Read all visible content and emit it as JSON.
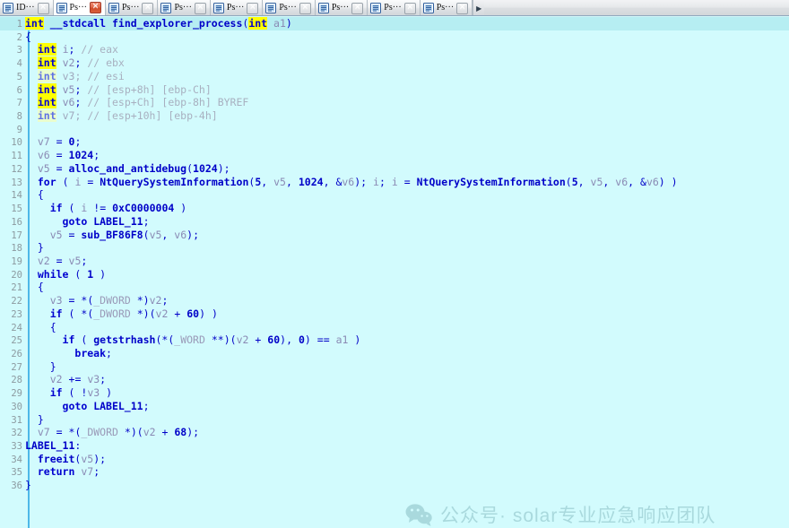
{
  "window": {
    "app": "IDA Pro Hex-Rays Pseudocode View",
    "accent_color": "#0000c8",
    "background_color": "#d2fbfd",
    "current_line_color": "#b6eef2",
    "highlight_color": "#ffff00",
    "gutter_rule_color": "#4db8e8"
  },
  "tabbar": {
    "scroll_right_glyph": "▶",
    "tabs": [
      {
        "label": "ID···",
        "icon": "document-icon",
        "active": false,
        "close_label": "✕",
        "close_style": "grey"
      },
      {
        "label": "Ps···",
        "icon": "document-icon",
        "active": true,
        "close_label": "✕",
        "close_style": "red"
      },
      {
        "label": "Ps···",
        "icon": "document-icon",
        "active": false,
        "close_label": "✕",
        "close_style": "grey"
      },
      {
        "label": "Ps···",
        "icon": "document-icon",
        "active": false,
        "close_label": "✕",
        "close_style": "grey"
      },
      {
        "label": "Ps···",
        "icon": "document-icon",
        "active": false,
        "close_label": "✕",
        "close_style": "grey"
      },
      {
        "label": "Ps···",
        "icon": "document-icon",
        "active": false,
        "close_label": "✕",
        "close_style": "grey"
      },
      {
        "label": "Ps···",
        "icon": "document-icon",
        "active": false,
        "close_label": "✕",
        "close_style": "grey"
      },
      {
        "label": "Ps···",
        "icon": "document-icon",
        "active": false,
        "close_label": "✕",
        "close_style": "grey"
      },
      {
        "label": "Ps···",
        "icon": "document-icon",
        "active": false,
        "close_label": "✕",
        "close_style": "grey"
      }
    ]
  },
  "code": {
    "function_name": "find_explorer_process",
    "lines": [
      {
        "n": "1",
        "current": true,
        "text": "int __stdcall find_explorer_process(int a1)"
      },
      {
        "n": "2",
        "current": false,
        "text": "{"
      },
      {
        "n": "3",
        "current": false,
        "text": "  int i; // eax"
      },
      {
        "n": "4",
        "current": false,
        "text": "  int v2; // ebx"
      },
      {
        "n": "5",
        "current": false,
        "text": "  int v3; // esi"
      },
      {
        "n": "6",
        "current": false,
        "text": "  int v5; // [esp+8h] [ebp-Ch]"
      },
      {
        "n": "7",
        "current": false,
        "text": "  int v6; // [esp+Ch] [ebp-8h] BYREF"
      },
      {
        "n": "8",
        "current": false,
        "text": "  int v7; // [esp+10h] [ebp-4h]"
      },
      {
        "n": "9",
        "current": false,
        "text": ""
      },
      {
        "n": "10",
        "current": false,
        "text": "  v7 = 0;"
      },
      {
        "n": "11",
        "current": false,
        "text": "  v6 = 1024;"
      },
      {
        "n": "12",
        "current": false,
        "text": "  v5 = alloc_and_antidebug(1024);"
      },
      {
        "n": "13",
        "current": false,
        "text": "  for ( i = NtQuerySystemInformation(5, v5, 1024, &v6); i; i = NtQuerySystemInformation(5, v5, v6, &v6) )"
      },
      {
        "n": "14",
        "current": false,
        "text": "  {"
      },
      {
        "n": "15",
        "current": false,
        "text": "    if ( i != 0xC0000004 )"
      },
      {
        "n": "16",
        "current": false,
        "text": "      goto LABEL_11;"
      },
      {
        "n": "17",
        "current": false,
        "text": "    v5 = sub_BF86F8(v5, v6);"
      },
      {
        "n": "18",
        "current": false,
        "text": "  }"
      },
      {
        "n": "19",
        "current": false,
        "text": "  v2 = v5;"
      },
      {
        "n": "20",
        "current": false,
        "text": "  while ( 1 )"
      },
      {
        "n": "21",
        "current": false,
        "text": "  {"
      },
      {
        "n": "22",
        "current": false,
        "text": "    v3 = *(_DWORD *)v2;"
      },
      {
        "n": "23",
        "current": false,
        "text": "    if ( *(_DWORD *)(v2 + 60) )"
      },
      {
        "n": "24",
        "current": false,
        "text": "    {"
      },
      {
        "n": "25",
        "current": false,
        "text": "      if ( getstrhash(*(_WORD **)(v2 + 60), 0) == a1 )"
      },
      {
        "n": "26",
        "current": false,
        "text": "        break;"
      },
      {
        "n": "27",
        "current": false,
        "text": "    }"
      },
      {
        "n": "28",
        "current": false,
        "text": "    v2 += v3;"
      },
      {
        "n": "29",
        "current": false,
        "text": "    if ( !v3 )"
      },
      {
        "n": "30",
        "current": false,
        "text": "      goto LABEL_11;"
      },
      {
        "n": "31",
        "current": false,
        "text": "  }"
      },
      {
        "n": "32",
        "current": false,
        "text": "  v7 = *(_DWORD *)(v2 + 68);"
      },
      {
        "n": "33",
        "current": false,
        "text": "LABEL_11:"
      },
      {
        "n": "34",
        "current": false,
        "text": "  freeit(v5);"
      },
      {
        "n": "35",
        "current": false,
        "text": "  return v7;"
      },
      {
        "n": "36",
        "current": false,
        "text": "}"
      }
    ]
  },
  "watermark": {
    "icon": "wechat-icon",
    "text": "公众号· solar专业应急响应团队",
    "color": "#a9d9dd"
  }
}
